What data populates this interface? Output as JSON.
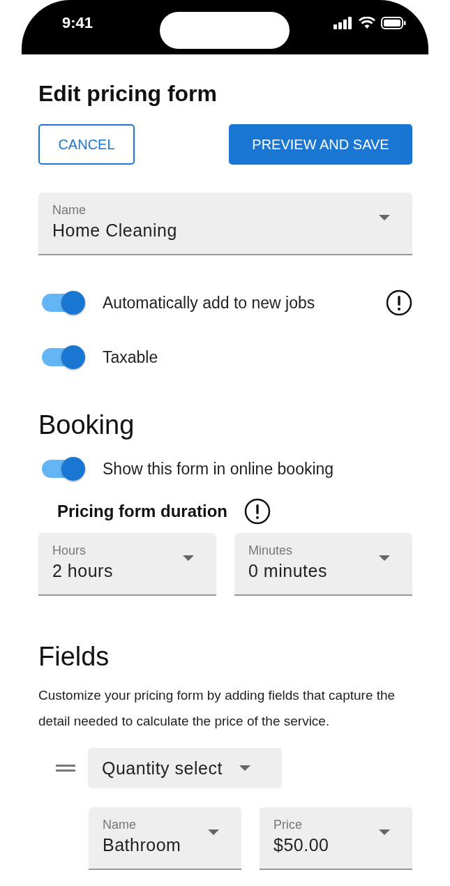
{
  "status_bar": {
    "time": "9:41"
  },
  "title": "Edit pricing form",
  "buttons": [
    {
      "label": "CANCEL",
      "kind": "outlined"
    },
    {
      "label": "PREVIEW AND SAVE",
      "kind": "filled"
    }
  ],
  "name_select": {
    "label": "Name",
    "value": "Home Cleaning"
  },
  "toggles": [
    {
      "label": "Automatically add to new jobs",
      "on": true,
      "info": true
    },
    {
      "label": "Taxable",
      "on": true,
      "info": false
    }
  ],
  "booking": {
    "heading": "Booking",
    "toggles": [
      {
        "label": "Show this form in online booking",
        "on": true,
        "info": false
      }
    ],
    "duration_label": "Pricing form duration",
    "duration_selects": [
      {
        "label": "Hours",
        "value": "2 hours"
      },
      {
        "label": "Minutes",
        "value": "0 minutes"
      }
    ]
  },
  "fields": {
    "heading": "Fields",
    "description": "Customize your pricing form by adding fields that capture the detail needed to calculate the price of the service.",
    "field_type": "Quantity select",
    "selects": [
      {
        "label": "Name",
        "value": "Bathroom"
      },
      {
        "label": "Price",
        "value": "$50.00"
      }
    ]
  }
}
